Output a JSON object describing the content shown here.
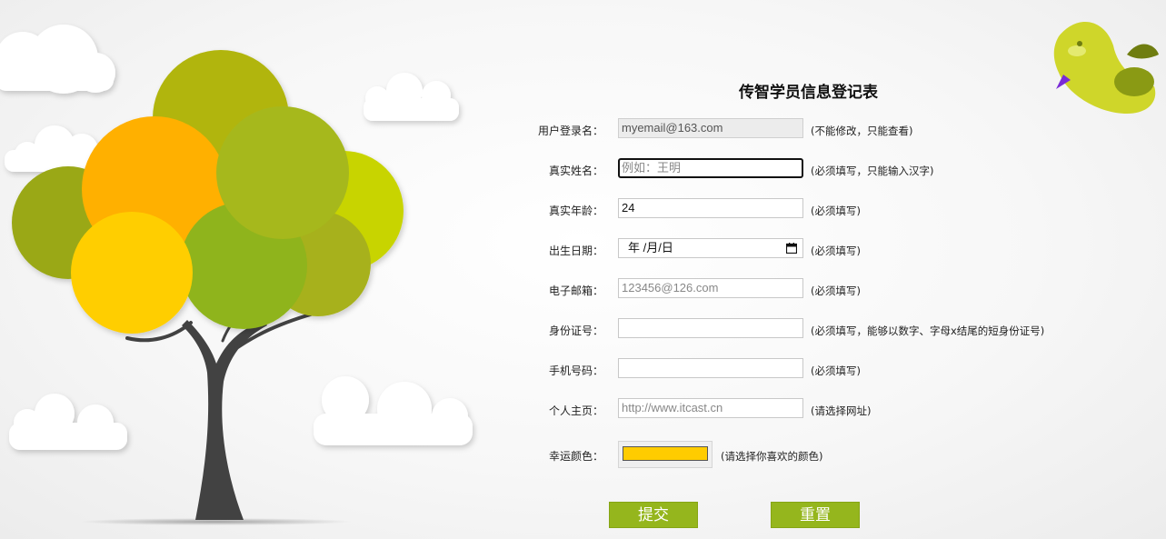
{
  "form": {
    "title": "传智学员信息登记表",
    "fields": [
      {
        "label": "用户登录名：",
        "value": "myemail@163.com",
        "placeholder": "",
        "hint": "(不能修改，只能查看)"
      },
      {
        "label": "真实姓名：",
        "value": "",
        "placeholder": "例如：王明",
        "hint": "(必须填写，只能输入汉字)"
      },
      {
        "label": "真实年龄：",
        "value": "24",
        "placeholder": "",
        "hint": "(必须填写)"
      },
      {
        "label": "出生日期：",
        "value": "年 /月/日",
        "placeholder": "",
        "hint": "(必须填写)"
      },
      {
        "label": "电子邮箱：",
        "value": "",
        "placeholder": "123456@126.com",
        "hint": "(必须填写)"
      },
      {
        "label": "身份证号：",
        "value": "",
        "placeholder": "",
        "hint": "(必须填写，能够以数字、字母x结尾的短身份证号)"
      },
      {
        "label": "手机号码：",
        "value": "",
        "placeholder": "",
        "hint": "(必须填写)"
      },
      {
        "label": "个人主页：",
        "value": "",
        "placeholder": "http://www.itcast.cn",
        "hint": "(请选择网址)"
      },
      {
        "label": "幸运颜色：",
        "value": "#ffcc00",
        "placeholder": "",
        "hint": "(请选择你喜欢的颜色)"
      }
    ],
    "buttons": {
      "submit": "提交",
      "reset": "重置"
    }
  },
  "colors": {
    "button_bg": "#95b61d",
    "tree_canopy": [
      "#b1b510",
      "#ffb000",
      "#a6b81e",
      "#c8d400",
      "#9aa818",
      "#8fb41c",
      "#ffce00",
      "#a7b11a"
    ],
    "bird_body": "#cfd62a"
  },
  "icons": {
    "date": "calendar-icon"
  }
}
